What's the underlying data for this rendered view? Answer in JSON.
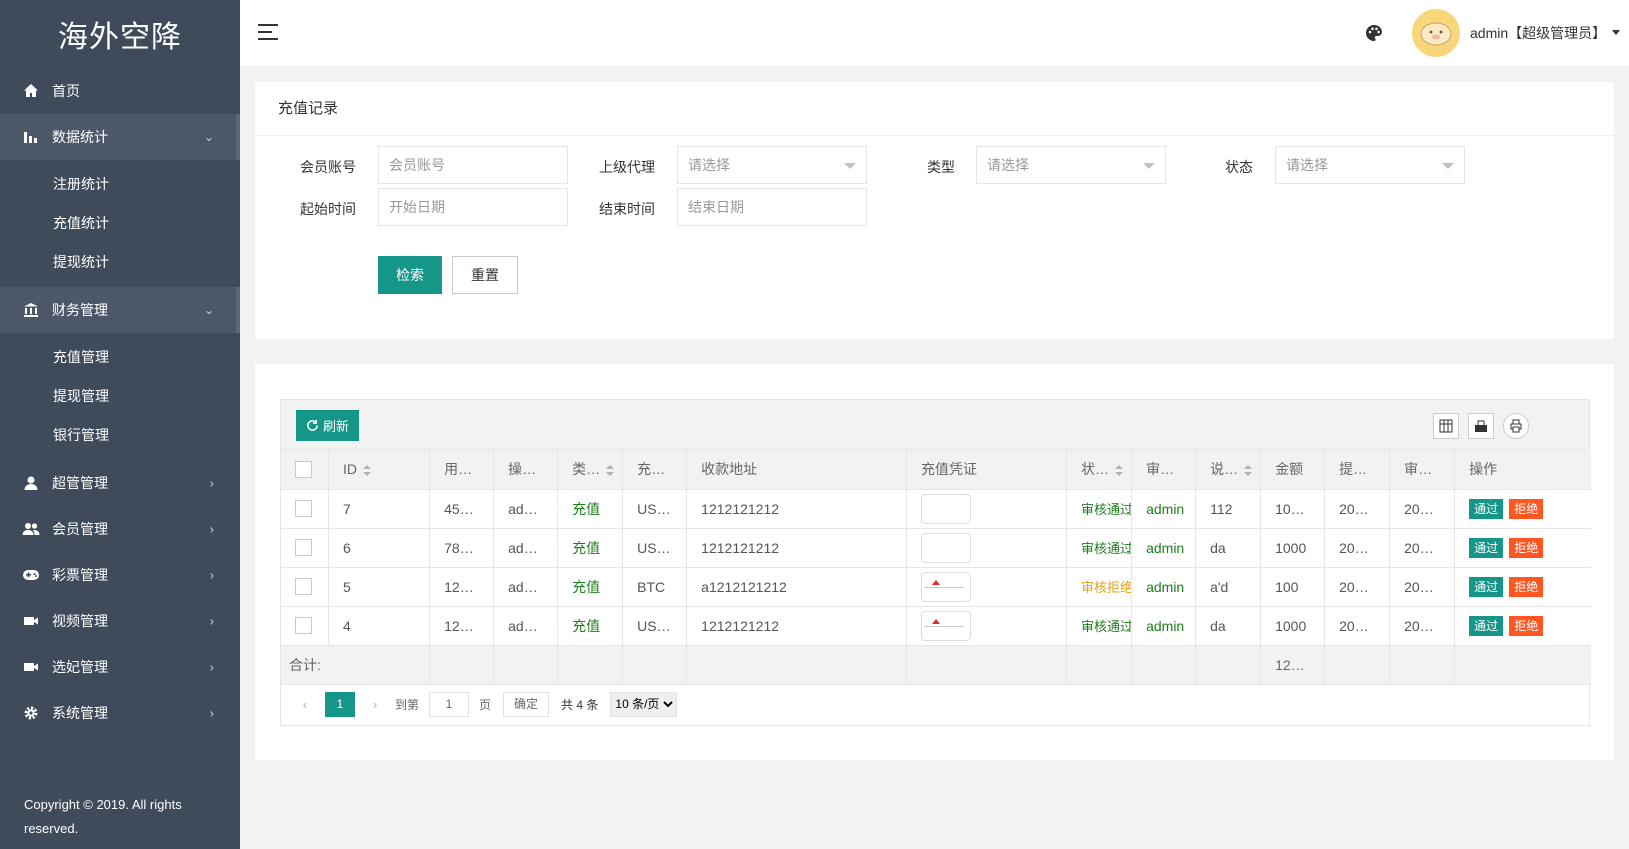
{
  "app": {
    "logo": "海外空降"
  },
  "sidebar": {
    "items": [
      {
        "label": "首页",
        "icon": "home-icon"
      },
      {
        "label": "数据统计",
        "icon": "bar-chart-icon",
        "open": true,
        "sub": [
          "注册统计",
          "充值统计",
          "提现统计"
        ]
      },
      {
        "label": "财务管理",
        "icon": "bank-icon",
        "open": true,
        "sub": [
          "充值管理",
          "提现管理",
          "银行管理"
        ]
      },
      {
        "label": "超管管理",
        "icon": "user-icon"
      },
      {
        "label": "会员管理",
        "icon": "users-icon"
      },
      {
        "label": "彩票管理",
        "icon": "gamepad-icon"
      },
      {
        "label": "视频管理",
        "icon": "video-icon"
      },
      {
        "label": "选妃管理",
        "icon": "video-icon"
      },
      {
        "label": "系统管理",
        "icon": "gear-icon"
      }
    ],
    "copyright": "Copyright © 2019. All rights reserved."
  },
  "header": {
    "user": "admin【超级管理员】"
  },
  "search": {
    "title": "充值记录",
    "member_label": "会员账号",
    "member_placeholder": "会员账号",
    "agent_label": "上级代理",
    "agent_value": "请选择",
    "type_label": "类型",
    "type_value": "请选择",
    "status_label": "状态",
    "status_value": "请选择",
    "start_label": "起始时间",
    "start_placeholder": "开始日期",
    "end_label": "结束时间",
    "end_placeholder": "结束日期",
    "search_btn": "检索",
    "reset_btn": "重置"
  },
  "table": {
    "refresh_label": "刷新",
    "headers": [
      "ID",
      "用…",
      "操…",
      "类…",
      "充…",
      "收款地址",
      "充值凭证",
      "状…",
      "审…",
      "说…",
      "金额",
      "提…",
      "审…",
      "操作"
    ],
    "rows": [
      {
        "id": "7",
        "user": "45…",
        "op": "ad…",
        "type": "充值",
        "coin": "US…",
        "address": "1212121212",
        "voucher": "blank",
        "status": "审核通过",
        "status_color": "#1e7e1e",
        "auditor": "admin",
        "note": "112",
        "amount": "10…",
        "submit": "20…",
        "audit_time": "20…"
      },
      {
        "id": "6",
        "user": "78…",
        "op": "ad…",
        "type": "充值",
        "coin": "US…",
        "address": "1212121212",
        "voucher": "blank",
        "status": "审核通过",
        "status_color": "#1e7e1e",
        "auditor": "admin",
        "note": "da",
        "amount": "1000",
        "submit": "20…",
        "audit_time": "20…"
      },
      {
        "id": "5",
        "user": "12…",
        "op": "ad…",
        "type": "充值",
        "coin": "BTC",
        "address": "a1212121212",
        "voucher": "img",
        "status": "审核拒绝",
        "status_color": "#e8a316",
        "auditor": "admin",
        "note": "a'd",
        "amount": "100",
        "submit": "20…",
        "audit_time": "20…"
      },
      {
        "id": "4",
        "user": "12…",
        "op": "ad…",
        "type": "充值",
        "coin": "US…",
        "address": "1212121212",
        "voucher": "img",
        "status": "审核通过",
        "status_color": "#1e7e1e",
        "auditor": "admin",
        "note": "da",
        "amount": "1000",
        "submit": "20…",
        "audit_time": "20…"
      }
    ],
    "pass_label": "通过",
    "reject_label": "拒绝",
    "total_label": "合计:",
    "total_amount": "12…"
  },
  "pager": {
    "current": "1",
    "goto_label": "到第",
    "goto_value": "1",
    "page_label": "页",
    "ok_label": "确定",
    "count_label": "共 4 条",
    "per_page": "10 条/页"
  },
  "colors": {
    "sidebar": "#3f4a5b",
    "accent": "#159688",
    "reject": "#ff5722"
  }
}
